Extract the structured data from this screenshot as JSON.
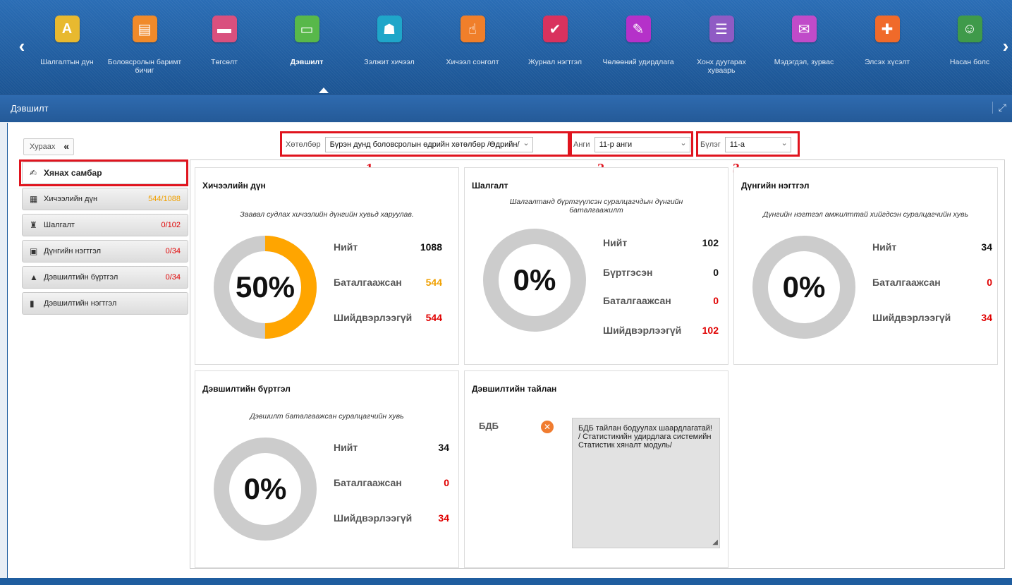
{
  "apps": [
    {
      "label": "Шалгалтын дүн",
      "color": "#e8b92f",
      "glyph": "A",
      "active": false
    },
    {
      "label": "Боловсролын баримт бичиг",
      "color": "#f08a2a",
      "glyph": "▤",
      "active": false
    },
    {
      "label": "Төгсөлт",
      "color": "#d9507e",
      "glyph": "▬",
      "active": false
    },
    {
      "label": "Дэвшилт",
      "color": "#58b84a",
      "glyph": "▭",
      "active": true
    },
    {
      "label": "Зэлжит хичээл",
      "color": "#1fa6c9",
      "glyph": "☗",
      "active": false
    },
    {
      "label": "Хичээл сонголт",
      "color": "#f07f2a",
      "glyph": "☝",
      "active": false
    },
    {
      "label": "Журнал нэгтгэл",
      "color": "#d9325e",
      "glyph": "✔",
      "active": false
    },
    {
      "label": "Чөлөөний удирдлага",
      "color": "#b531c9",
      "glyph": "✎",
      "active": false
    },
    {
      "label": "Хонх дуугарах хуваарь",
      "color": "#8f5bc4",
      "glyph": "☰",
      "active": false
    },
    {
      "label": "Мэдэгдэл, зурвас",
      "color": "#c04bc9",
      "glyph": "✉",
      "active": false
    },
    {
      "label": "Элсэх хүсэлт",
      "color": "#f06a2a",
      "glyph": "✚",
      "active": false
    },
    {
      "label": "Насан болс",
      "color": "#3f9a4a",
      "glyph": "☺",
      "active": false
    }
  ],
  "page_title": "Дэвшилт",
  "collapse_label": "Хураах",
  "filters": {
    "program_label": "Хөтөлбөр",
    "program_value": "Бүрэн дунд боловсролын өдрийн хөтөлбөр /Өдрийн/",
    "grade_label": "Анги",
    "grade_value": "11-р анги",
    "group_label": "Бүлэг",
    "group_value": "11-а"
  },
  "markers": [
    "1",
    "2",
    "3"
  ],
  "sidebar": [
    {
      "label": "Хянах самбар",
      "count": "",
      "icon": "✍",
      "active": true
    },
    {
      "label": "Хичээлийн дүн",
      "count": "544/1088",
      "count_color": "orange",
      "icon": "▦",
      "active": false
    },
    {
      "label": "Шалгалт",
      "count": "0/102",
      "count_color": "red",
      "icon": "♜",
      "active": false
    },
    {
      "label": "Дүнгийн нэгтгэл",
      "count": "0/34",
      "count_color": "red",
      "icon": "▣",
      "active": false
    },
    {
      "label": "Дэвшилтийн бүртгэл",
      "count": "0/34",
      "count_color": "red",
      "icon": "▲",
      "active": false
    },
    {
      "label": "Дэвшилтийн нэгтгэл",
      "count": "",
      "icon": "▮",
      "active": false
    }
  ],
  "cards": {
    "lesson": {
      "title": "Хичээлийн дүн",
      "desc": "Заавал судлах хичээлийн дүнгийн хувьд харуулав.",
      "percent_text": "50%",
      "percent": 50,
      "total_label": "Нийт",
      "total": "1088",
      "confirmed_label": "Баталгаажсан",
      "confirmed": "544",
      "unresolved_label": "Шийдвэрлээгүй",
      "unresolved": "544"
    },
    "exam": {
      "title": "Шалгалт",
      "desc": "Шалгалтанд бүртгүүлсэн суралцагчдын дүнгийн баталгаажилт",
      "percent_text": "0%",
      "percent": 0,
      "total_label": "Нийт",
      "total": "102",
      "registered_label": "Бүртгэсэн",
      "registered": "0",
      "confirmed_label": "Баталгаажсан",
      "confirmed": "0",
      "unresolved_label": "Шийдвэрлээгүй",
      "unresolved": "102"
    },
    "summary": {
      "title": "Дүнгийн нэгтгэл",
      "desc": "Дүнгийн нэгтгэл амжилттай хийгдсэн суралцагчийн хувь",
      "percent_text": "0%",
      "percent": 0,
      "total_label": "Нийт",
      "total": "34",
      "confirmed_label": "Баталгаажсан",
      "confirmed": "0",
      "unresolved_label": "Шийдвэрлээгүй",
      "unresolved": "34"
    },
    "promotion": {
      "title": "Дэвшилтийн бүртгэл",
      "desc": "Дэвшилт баталгаажсан суралцагчийн хувь",
      "percent_text": "0%",
      "percent": 0,
      "total_label": "Нийт",
      "total": "34",
      "confirmed_label": "Баталгаажсан",
      "confirmed": "0",
      "unresolved_label": "Шийдвэрлээгүй",
      "unresolved": "34"
    },
    "report": {
      "title": "Дэвшилтийн тайлан",
      "label": "БДБ",
      "text": "БДБ тайлан бодуулах шаардлагатай! / Статистикийн удирдлага системийн Статистик хяналт модуль/"
    }
  },
  "colors": {
    "accent": "#1f5d9f",
    "donut_fill": "#ffa500",
    "donut_track": "#cccccc",
    "highlight": "#e0141e",
    "orange": "#f0a000",
    "red": "#e00000"
  }
}
